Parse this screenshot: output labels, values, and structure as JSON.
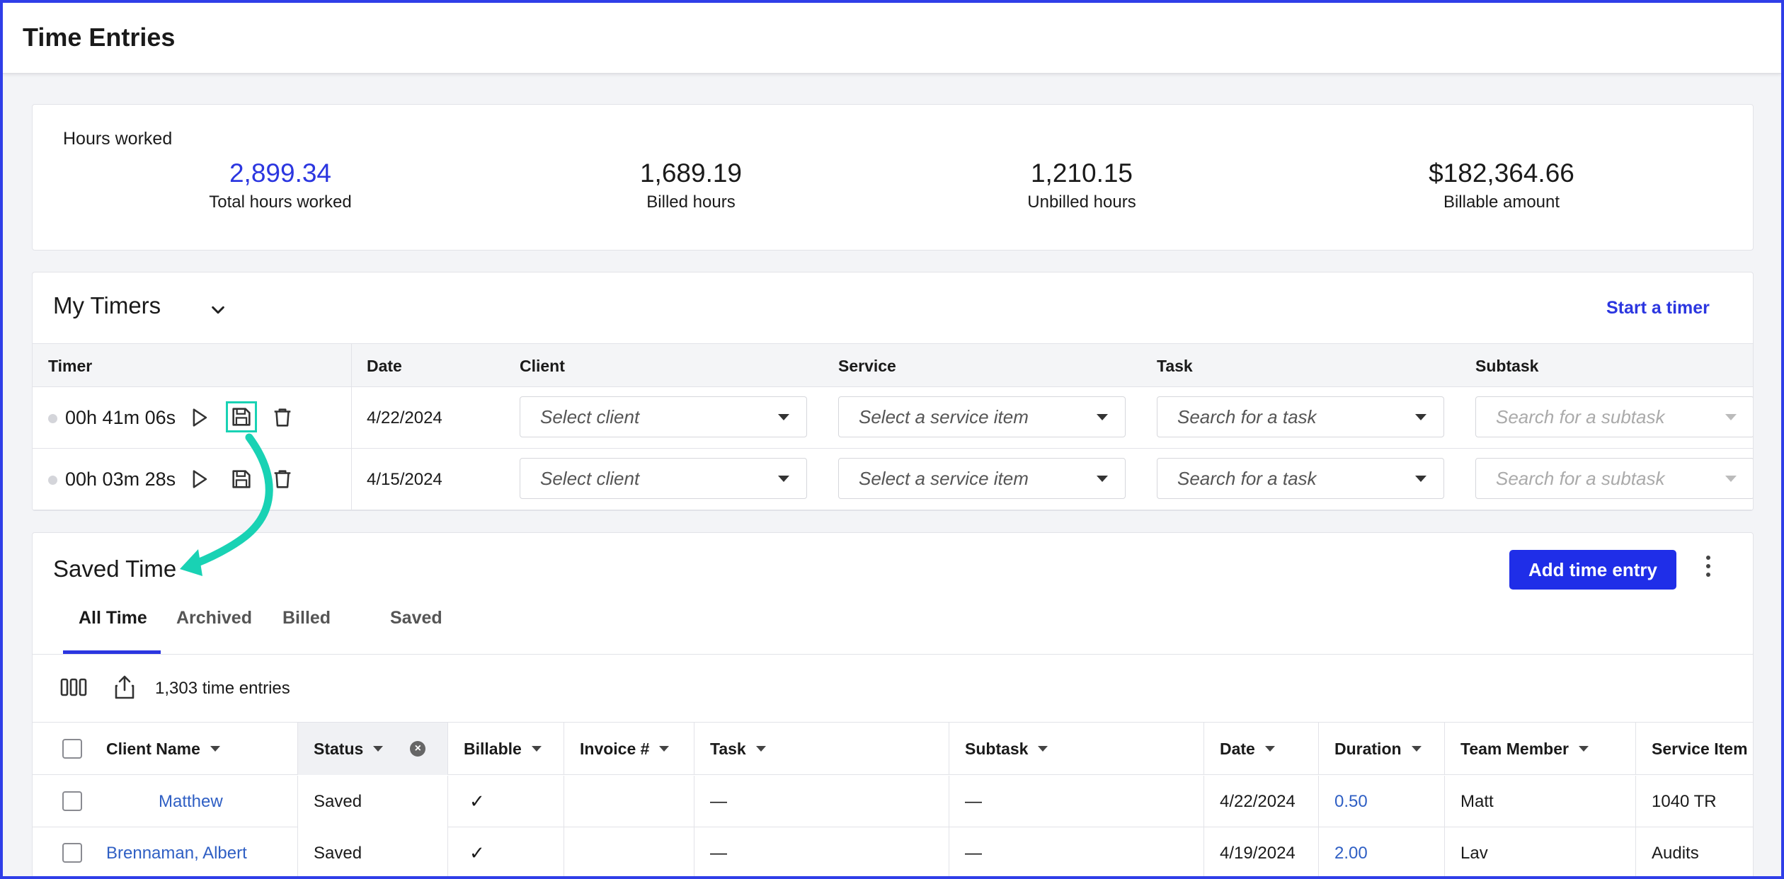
{
  "header": {
    "title": "Time Entries"
  },
  "hours": {
    "label": "Hours worked",
    "stats": [
      {
        "value": "2,899.34",
        "caption": "Total hours worked"
      },
      {
        "value": "1,689.19",
        "caption": "Billed hours"
      },
      {
        "value": "1,210.15",
        "caption": "Unbilled hours"
      },
      {
        "value": "$182,364.66",
        "caption": "Billable amount"
      }
    ]
  },
  "timers": {
    "title": "My Timers",
    "start_label": "Start a timer",
    "columns": [
      "Timer",
      "Date",
      "Client",
      "Service",
      "Task",
      "Subtask"
    ],
    "rows": [
      {
        "time": "00h 41m 06s",
        "date": "4/22/2024",
        "client": "Select client",
        "service": "Select a service item",
        "task": "Search for a task",
        "subtask": "Search for a subtask"
      },
      {
        "time": "00h 03m 28s",
        "date": "4/15/2024",
        "client": "Select client",
        "service": "Select a service item",
        "task": "Search for a task",
        "subtask": "Search for a subtask"
      }
    ]
  },
  "saved": {
    "title": "Saved Time",
    "add_label": "Add time entry",
    "tabs": [
      "All Time",
      "Archived",
      "Billed",
      "Saved"
    ],
    "active_tab": "All Time",
    "entries_count": "1,303 time entries",
    "columns": [
      "Client Name",
      "Status",
      "Billable",
      "Invoice #",
      "Task",
      "Subtask",
      "Date",
      "Duration",
      "Team Member",
      "Service Item"
    ],
    "rows": [
      {
        "client": "Matthew",
        "status": "Saved",
        "billable": "✓",
        "invoice": "",
        "task": "—",
        "subtask": "—",
        "date": "4/22/2024",
        "duration": "0.50",
        "member": "Matt",
        "service": "1040 TR"
      },
      {
        "client": "Brennaman, Albert",
        "status": "Saved",
        "billable": "✓",
        "invoice": "",
        "task": "—",
        "subtask": "—",
        "date": "4/19/2024",
        "duration": "2.00",
        "member": "Lav",
        "service": "Audits"
      }
    ]
  },
  "colors": {
    "accent": "#2b36e0",
    "highlight": "#19d2b4",
    "link": "#2f5fc4"
  },
  "icons": [
    "chevron-down-icon",
    "play-icon",
    "save-icon",
    "trash-icon",
    "columns-icon",
    "export-icon",
    "kebab-icon",
    "clear-filter-icon",
    "annotation-arrow"
  ]
}
